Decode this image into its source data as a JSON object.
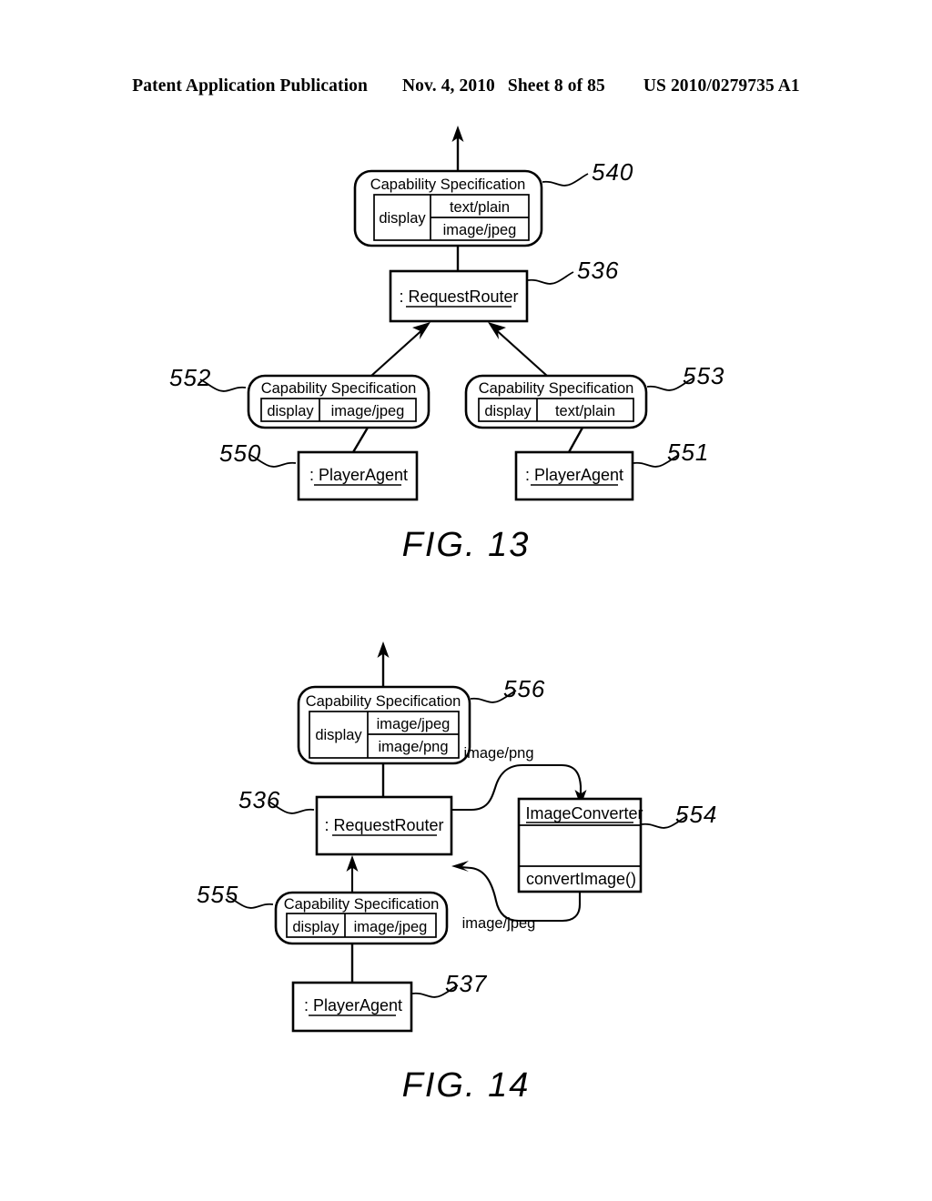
{
  "header": {
    "title": "Patent Application Publication",
    "date": "Nov. 4, 2010",
    "sheet": "Sheet 8 of 85",
    "number": "US 2010/0279735 A1"
  },
  "figures": [
    {
      "caption": "FIG. 13",
      "nodes": {
        "top_capability_spec": {
          "title": "Capability Specification",
          "key": "display",
          "values": [
            "text/plain",
            "image/jpeg"
          ],
          "ref": "540"
        },
        "request_router": {
          "label": ": RequestRouter",
          "ref": "536"
        },
        "left_capability_spec": {
          "title": "Capability Specification",
          "key": "display",
          "values": [
            "image/jpeg"
          ],
          "ref": "552"
        },
        "right_capability_spec": {
          "title": "Capability Specification",
          "key": "display",
          "values": [
            "text/plain"
          ],
          "ref": "553"
        },
        "left_player_agent": {
          "label": ": PlayerAgent",
          "ref": "550"
        },
        "right_player_agent": {
          "label": ": PlayerAgent",
          "ref": "551"
        }
      }
    },
    {
      "caption": "FIG. 14",
      "nodes": {
        "top_capability_spec": {
          "title": "Capability Specification",
          "key": "display",
          "values": [
            "image/jpeg",
            "image/png"
          ],
          "ref": "556"
        },
        "request_router": {
          "label": ": RequestRouter",
          "ref": "536"
        },
        "image_converter": {
          "label": ": ImageConverter",
          "attributes": "",
          "operation": "convertImage()",
          "ref": "554"
        },
        "bottom_capability_spec": {
          "title": "Capability Specification",
          "key": "display",
          "values": [
            "image/jpeg"
          ],
          "ref": "555"
        },
        "player_agent": {
          "label": ": PlayerAgent",
          "ref": "537"
        }
      },
      "edge_labels": {
        "to_converter": "image/png",
        "from_converter": "image/jpeg"
      }
    }
  ]
}
